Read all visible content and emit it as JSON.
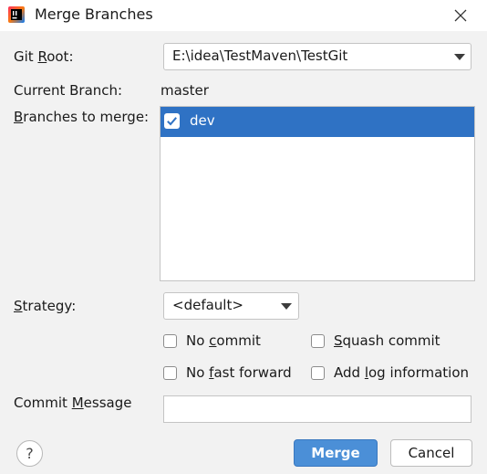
{
  "window": {
    "title": "Merge Branches",
    "icon": "intellij-idea-icon"
  },
  "form": {
    "git_root_label": "Git Root:",
    "git_root_value": "E:\\idea\\TestMaven\\TestGit",
    "current_branch_label": "Current Branch:",
    "current_branch_value": "master",
    "branches_label": "Branches to merge:",
    "branches": [
      {
        "name": "dev",
        "checked": true,
        "selected": true
      }
    ],
    "strategy_label": "Strategy:",
    "strategy_value": "<default>",
    "options": {
      "no_commit": "No commit",
      "squash_commit": "Squash commit",
      "no_fast_forward": "No fast forward",
      "add_log_information": "Add log information"
    },
    "commit_message_label": "Commit Message",
    "commit_message_value": ""
  },
  "footer": {
    "help_label": "?",
    "merge_label": "Merge",
    "cancel_label": "Cancel"
  },
  "colors": {
    "selection": "#2f72c4",
    "primary_button": "#4b8fd7",
    "dialog_background": "#f2f2f2"
  }
}
